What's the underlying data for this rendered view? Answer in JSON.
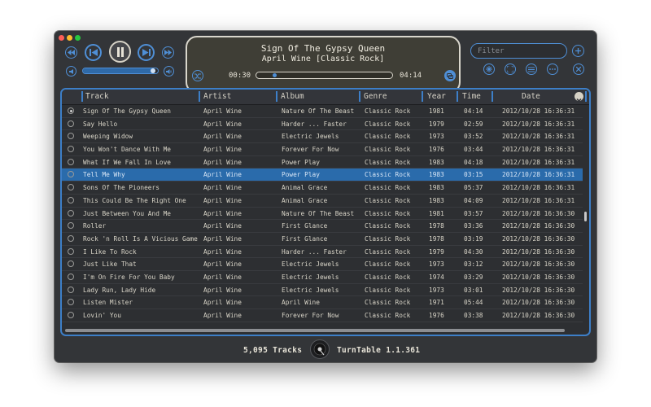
{
  "player": {
    "track_title": "Sign Of The Gypsy Queen",
    "track_subtitle": "April Wine [Classic Rock]",
    "elapsed": "00:30",
    "remaining": "04:14",
    "progress_fraction": 0.12,
    "volume_fraction": 0.97
  },
  "filter": {
    "placeholder": "Filter",
    "value": ""
  },
  "columns": [
    "Track",
    "Artist",
    "Album",
    "Genre",
    "Year",
    "Time",
    "Date"
  ],
  "tracks": [
    {
      "track": "Sign Of The Gypsy Queen",
      "artist": "April Wine",
      "album": "Nature Of The Beast",
      "genre": "Classic Rock",
      "year": "1981",
      "time": "04:14",
      "date": "2012/10/28 16:36:31",
      "playing": true,
      "selected": false
    },
    {
      "track": "Say Hello",
      "artist": "April Wine",
      "album": "Harder ... Faster",
      "genre": "Classic Rock",
      "year": "1979",
      "time": "02:59",
      "date": "2012/10/28 16:36:31",
      "playing": false,
      "selected": false
    },
    {
      "track": "Weeping Widow",
      "artist": "April Wine",
      "album": "Electric Jewels",
      "genre": "Classic Rock",
      "year": "1973",
      "time": "03:52",
      "date": "2012/10/28 16:36:31",
      "playing": false,
      "selected": false
    },
    {
      "track": "You Won't Dance With Me",
      "artist": "April Wine",
      "album": "Forever For Now",
      "genre": "Classic Rock",
      "year": "1976",
      "time": "03:44",
      "date": "2012/10/28 16:36:31",
      "playing": false,
      "selected": false
    },
    {
      "track": "What If We Fall In Love",
      "artist": "April Wine",
      "album": "Power Play",
      "genre": "Classic Rock",
      "year": "1983",
      "time": "04:18",
      "date": "2012/10/28 16:36:31",
      "playing": false,
      "selected": false
    },
    {
      "track": "Tell Me Why",
      "artist": "April Wine",
      "album": "Power Play",
      "genre": "Classic Rock",
      "year": "1983",
      "time": "03:15",
      "date": "2012/10/28 16:36:31",
      "playing": false,
      "selected": true
    },
    {
      "track": "Sons Of The Pioneers",
      "artist": "April Wine",
      "album": "Animal Grace",
      "genre": "Classic Rock",
      "year": "1983",
      "time": "05:37",
      "date": "2012/10/28 16:36:31",
      "playing": false,
      "selected": false
    },
    {
      "track": "This Could Be The Right One",
      "artist": "April Wine",
      "album": "Animal Grace",
      "genre": "Classic Rock",
      "year": "1983",
      "time": "04:09",
      "date": "2012/10/28 16:36:31",
      "playing": false,
      "selected": false
    },
    {
      "track": "Just Between You And Me",
      "artist": "April Wine",
      "album": "Nature Of The Beast",
      "genre": "Classic Rock",
      "year": "1981",
      "time": "03:57",
      "date": "2012/10/28 16:36:30",
      "playing": false,
      "selected": false
    },
    {
      "track": "Roller",
      "artist": "April Wine",
      "album": "First Glance",
      "genre": "Classic Rock",
      "year": "1978",
      "time": "03:36",
      "date": "2012/10/28 16:36:30",
      "playing": false,
      "selected": false
    },
    {
      "track": "Rock 'n Roll Is A Vicious Game",
      "artist": "April Wine",
      "album": "First Glance",
      "genre": "Classic Rock",
      "year": "1978",
      "time": "03:19",
      "date": "2012/10/28 16:36:30",
      "playing": false,
      "selected": false
    },
    {
      "track": "I Like To Rock",
      "artist": "April Wine",
      "album": "Harder ... Faster",
      "genre": "Classic Rock",
      "year": "1979",
      "time": "04:30",
      "date": "2012/10/28 16:36:30",
      "playing": false,
      "selected": false
    },
    {
      "track": "Just Like That",
      "artist": "April Wine",
      "album": "Electric Jewels",
      "genre": "Classic Rock",
      "year": "1973",
      "time": "03:12",
      "date": "2012/10/28 16:36:30",
      "playing": false,
      "selected": false
    },
    {
      "track": "I'm On Fire For You Baby",
      "artist": "April Wine",
      "album": "Electric Jewels",
      "genre": "Classic Rock",
      "year": "1974",
      "time": "03:29",
      "date": "2012/10/28 16:36:30",
      "playing": false,
      "selected": false
    },
    {
      "track": "Lady Run, Lady Hide",
      "artist": "April Wine",
      "album": "Electric Jewels",
      "genre": "Classic Rock",
      "year": "1973",
      "time": "03:01",
      "date": "2012/10/28 16:36:30",
      "playing": false,
      "selected": false
    },
    {
      "track": "Listen Mister",
      "artist": "April Wine",
      "album": "April Wine",
      "genre": "Classic Rock",
      "year": "1971",
      "time": "05:44",
      "date": "2012/10/28 16:36:30",
      "playing": false,
      "selected": false
    },
    {
      "track": "Lovin' You",
      "artist": "April Wine",
      "album": "Forever For Now",
      "genre": "Classic Rock",
      "year": "1976",
      "time": "03:38",
      "date": "2012/10/28 16:36:30",
      "playing": false,
      "selected": false
    }
  ],
  "footer": {
    "track_count": "5,095 Tracks",
    "app_name": "TurnTable 1.1.361"
  },
  "icons": {
    "rewind": "rewind-icon",
    "previous": "previous-icon",
    "pause": "pause-icon",
    "next": "next-icon",
    "fast_forward": "fast-forward-icon",
    "volume_down": "volume-down-icon",
    "volume_up": "volume-up-icon",
    "shuffle": "shuffle-icon",
    "repeat": "repeat-icon",
    "add": "plus-icon",
    "close": "close-icon",
    "snowflake": "snowflake-icon",
    "fullscreen": "fullscreen-icon",
    "list": "list-icon",
    "more": "more-icon",
    "sort": "chevron-down-icon"
  },
  "colors": {
    "accent": "#4f8fd6",
    "selection": "#2a6bab",
    "window_bg": "#333538",
    "lcd_bg": "#3f3e36",
    "text": "#d9d5c8"
  }
}
